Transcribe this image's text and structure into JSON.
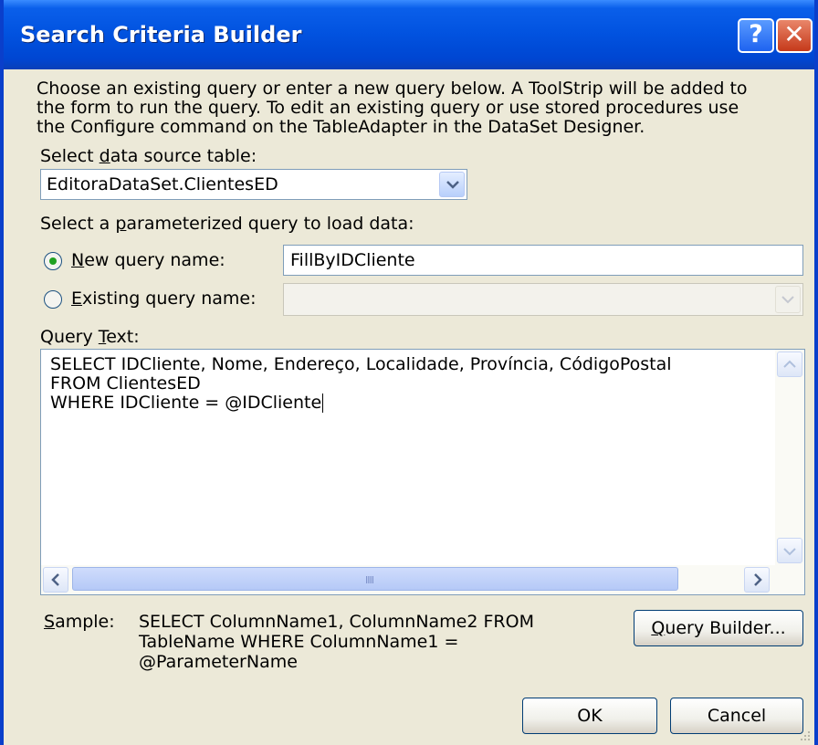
{
  "window": {
    "title": "Search Criteria Builder"
  },
  "titlebar_buttons": {
    "help": "?",
    "close": "✕"
  },
  "intro": {
    "line1": "Choose an existing query or enter a new query below. A ToolStrip will be added to",
    "line2": "the form to run the query. To edit an existing query or use stored procedures use",
    "line3": "the Configure command on the TableAdapter in the DataSet Designer."
  },
  "data_source": {
    "label_pre": "Select ",
    "label_accel": "d",
    "label_post": "ata source table:",
    "value": "EditoraDataSet.ClientesED"
  },
  "param_query": {
    "label_pre": "Select a ",
    "label_accel": "p",
    "label_post": "arameterized query to load data:"
  },
  "new_query": {
    "accel": "N",
    "label_rest": "ew query name:",
    "value": "FillByIDCliente",
    "selected": true
  },
  "existing_query": {
    "accel": "E",
    "label_rest": "xisting query name:",
    "value": "",
    "selected": false
  },
  "query_text": {
    "label_pre": "Query ",
    "label_accel": "T",
    "label_post": "ext:",
    "line1": "SELECT IDCliente, Nome, Endereço, Localidade, Província, CódigoPostal",
    "line2": "FROM ClientesED",
    "line3": "WHERE IDCliente = @IDCliente"
  },
  "sample": {
    "label_accel": "S",
    "label_rest": "ample:",
    "line1": "SELECT ColumnName1, ColumnName2 FROM",
    "line2": "TableName WHERE ColumnName1 =",
    "line3": "@ParameterName"
  },
  "buttons": {
    "query_builder_accel": "Q",
    "query_builder_rest": "uery Builder...",
    "ok": "OK",
    "cancel": "Cancel"
  }
}
